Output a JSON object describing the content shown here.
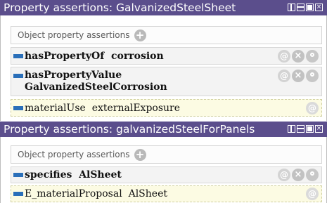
{
  "panels": [
    {
      "title": "Property assertions: GalvanizedSteelSheet",
      "section_label": "Object property assertions",
      "rows": [
        {
          "property": "hasPropertyOf",
          "value": "corrosion"
        },
        {
          "property": "hasPropertyValue",
          "value": "GalvanizedSteelCorrosion"
        },
        {
          "property": "materialUse",
          "value": "externalExposure"
        }
      ]
    },
    {
      "title": "Property assertions: galvanizedSteelForPanels",
      "section_label": "Object property assertions",
      "rows": [
        {
          "property": "specifies",
          "value": "AlSheet"
        },
        {
          "property": "E_materialProposal",
          "value": "AlSheet"
        }
      ]
    }
  ],
  "icons": {
    "add": "+",
    "annotate": "@",
    "delete": "×",
    "window_controls": [
      "tile",
      "split",
      "maximize",
      "close"
    ]
  },
  "colors": {
    "title_bar": "#5b4e8c",
    "property_bar": "#2a6fb9",
    "inferred_row": "#fcfbe3"
  }
}
